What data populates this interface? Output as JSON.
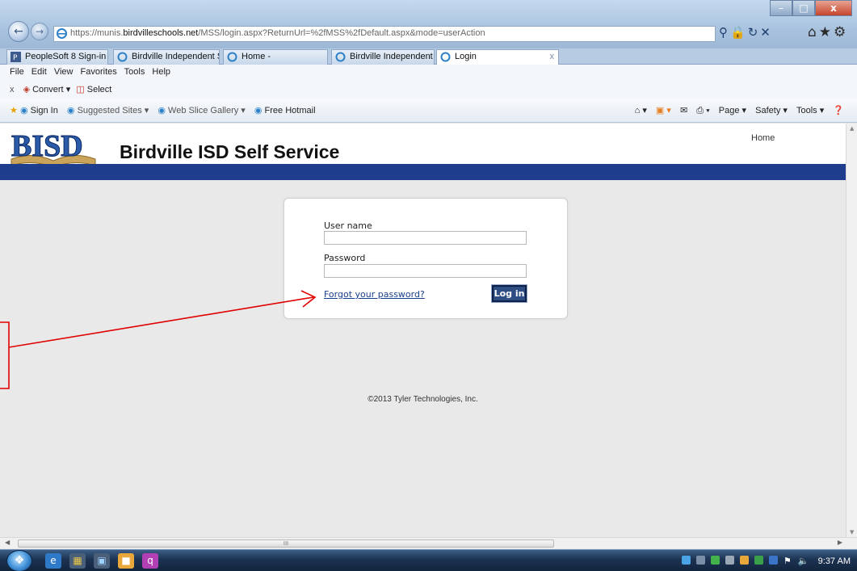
{
  "browser": {
    "url_prefix": "https://munis.",
    "url_host": "birdvilleschools.net",
    "url_path": "/MSS/login.aspx?ReturnUrl=%2fMSS%2fDefault.aspx&mode=userAction",
    "window_controls": {
      "minimize": "–",
      "restore": "□",
      "close": "x"
    },
    "tabs": [
      {
        "label": "PeopleSoft 8 Sign-in",
        "icon": "peoplesoft-icon"
      },
      {
        "label": "Birdville Independent S...",
        "icon": "ie-icon"
      },
      {
        "label": "Home -",
        "icon": "ie-icon"
      },
      {
        "label": "Birdville Independent S...",
        "icon": "ie-icon"
      },
      {
        "label": "Login",
        "icon": "ie-icon",
        "active": true
      }
    ],
    "tab_close": "x",
    "menu": [
      "File",
      "Edit",
      "View",
      "Favorites",
      "Tools",
      "Help"
    ],
    "convert_bar": {
      "close": "x",
      "convert": "Convert",
      "select": "Select"
    },
    "favorites": [
      {
        "label": "Sign In"
      },
      {
        "label": "Suggested Sites ▾"
      },
      {
        "label": "Web Slice Gallery ▾"
      },
      {
        "label": "Free Hotmail"
      }
    ],
    "command_bar": [
      "Page ▾",
      "Safety ▾",
      "Tools ▾"
    ]
  },
  "page": {
    "logo_text": "BISD",
    "title": "Birdville ISD Self Service",
    "home_link": "Home",
    "login": {
      "username_label": "User name",
      "username_value": "",
      "password_label": "Password",
      "password_value": "",
      "forgot_link": "Forgot your password?",
      "login_button": "Log in"
    },
    "copyright": "©2013 Tyler Technologies, Inc."
  },
  "scrollbar": {
    "thumb_grip": "III"
  },
  "taskbar": {
    "clock": "9:37 AM"
  },
  "colors": {
    "accent_band": "#1e3d8c",
    "annotation": "#e00000",
    "button": "#2d4d83"
  }
}
